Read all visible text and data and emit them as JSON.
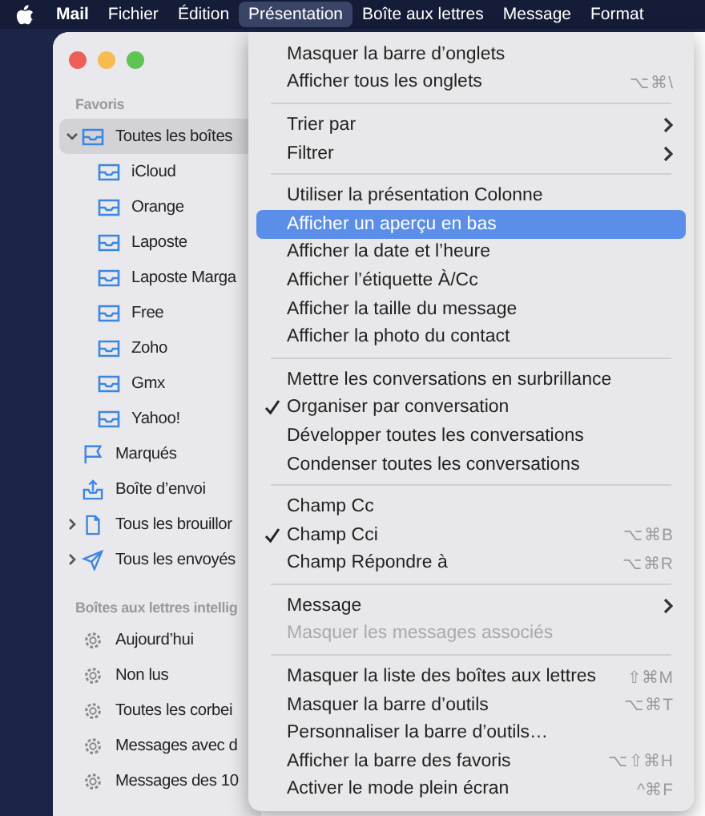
{
  "menu_bar": {
    "app": "Mail",
    "menus": [
      {
        "label": "Fichier",
        "selected": false
      },
      {
        "label": "Édition",
        "selected": false
      },
      {
        "label": "Présentation",
        "selected": true
      },
      {
        "label": "Boîte aux lettres",
        "selected": false
      },
      {
        "label": "Message",
        "selected": false
      },
      {
        "label": "Format",
        "selected": false
      }
    ]
  },
  "sidebar": {
    "sections": [
      {
        "title": "Favoris",
        "items": [
          {
            "label": "Toutes les boîtes",
            "kind": "mailbox",
            "selected": true,
            "expanded": true,
            "children": [
              {
                "label": "iCloud",
                "kind": "mailbox",
                "selected": false
              },
              {
                "label": "Orange",
                "kind": "mailbox",
                "selected": false
              },
              {
                "label": "Laposte",
                "kind": "mailbox",
                "selected": false
              },
              {
                "label": "Laposte Marga",
                "kind": "mailbox",
                "selected": false
              },
              {
                "label": "Free",
                "kind": "mailbox",
                "selected": false
              },
              {
                "label": "Zoho",
                "kind": "mailbox",
                "selected": false
              },
              {
                "label": "Gmx",
                "kind": "mailbox",
                "selected": false
              },
              {
                "label": "Yahoo!",
                "kind": "mailbox",
                "selected": false
              }
            ]
          },
          {
            "label": "Marqués",
            "kind": "flag",
            "selected": false
          },
          {
            "label": "Boîte d’envoi",
            "kind": "outbox",
            "selected": false
          },
          {
            "label": "Tous les brouillor",
            "kind": "draft",
            "selected": false,
            "expanded": false
          },
          {
            "label": "Tous les envoyés",
            "kind": "sent",
            "selected": false,
            "expanded": false
          }
        ]
      },
      {
        "title": "Boîtes aux lettres intellig",
        "items": [
          {
            "label": "Aujourd’hui",
            "kind": "smart",
            "selected": false
          },
          {
            "label": "Non lus",
            "kind": "smart",
            "selected": false
          },
          {
            "label": "Toutes les corbei",
            "kind": "smart",
            "selected": false
          },
          {
            "label": "Messages avec d",
            "kind": "smart",
            "selected": false
          },
          {
            "label": "Messages des 10",
            "kind": "smart",
            "selected": false
          }
        ]
      }
    ]
  },
  "dropdown_menu": {
    "groups": [
      [
        {
          "label": "Masquer la barre d’onglets",
          "selected": false,
          "checked": false,
          "disabled": false
        },
        {
          "label": "Afficher tous les onglets",
          "shortcut": "⌥⌘\\",
          "selected": false,
          "checked": false,
          "disabled": false
        }
      ],
      [
        {
          "label": "Trier par",
          "submenu": true,
          "selected": false,
          "checked": false,
          "disabled": false
        },
        {
          "label": "Filtrer",
          "submenu": true,
          "selected": false,
          "checked": false,
          "disabled": false
        }
      ],
      [
        {
          "label": "Utiliser la présentation Colonne",
          "selected": false,
          "checked": false,
          "disabled": false
        },
        {
          "label": "Afficher un aperçu en bas",
          "selected": true,
          "checked": false,
          "disabled": false
        },
        {
          "label": "Afficher la date et l’heure",
          "selected": false,
          "checked": false,
          "disabled": false
        },
        {
          "label": "Afficher l’étiquette À/Cc",
          "selected": false,
          "checked": false,
          "disabled": false
        },
        {
          "label": "Afficher la taille du message",
          "selected": false,
          "checked": false,
          "disabled": false
        },
        {
          "label": "Afficher la photo du contact",
          "selected": false,
          "checked": false,
          "disabled": false
        }
      ],
      [
        {
          "label": "Mettre les conversations en surbrillance",
          "selected": false,
          "checked": false,
          "disabled": false
        },
        {
          "label": "Organiser par conversation",
          "selected": false,
          "checked": true,
          "disabled": false
        },
        {
          "label": "Développer toutes les conversations",
          "selected": false,
          "checked": false,
          "disabled": false
        },
        {
          "label": "Condenser toutes les conversations",
          "selected": false,
          "checked": false,
          "disabled": false
        }
      ],
      [
        {
          "label": "Champ Cc",
          "selected": false,
          "checked": false,
          "disabled": false
        },
        {
          "label": "Champ Cci",
          "shortcut": "⌥⌘B",
          "selected": false,
          "checked": true,
          "disabled": false
        },
        {
          "label": "Champ Répondre à",
          "shortcut": "⌥⌘R",
          "selected": false,
          "checked": false,
          "disabled": false
        }
      ],
      [
        {
          "label": "Message",
          "submenu": true,
          "selected": false,
          "checked": false,
          "disabled": false
        },
        {
          "label": "Masquer les messages associés",
          "selected": false,
          "checked": false,
          "disabled": true
        }
      ],
      [
        {
          "label": "Masquer la liste des boîtes aux lettres",
          "shortcut": "⇧⌘M",
          "selected": false,
          "checked": false,
          "disabled": false
        },
        {
          "label": "Masquer la barre d’outils",
          "shortcut": "⌥⌘T",
          "selected": false,
          "checked": false,
          "disabled": false
        },
        {
          "label": "Personnaliser la barre d’outils…",
          "selected": false,
          "checked": false,
          "disabled": false
        },
        {
          "label": "Afficher la barre des favoris",
          "shortcut": "⌥⇧⌘H",
          "selected": false,
          "checked": false,
          "disabled": false
        },
        {
          "label": "Activer le mode plein écran",
          "shortcut": "^⌘F",
          "selected": false,
          "checked": false,
          "disabled": false
        }
      ]
    ]
  }
}
